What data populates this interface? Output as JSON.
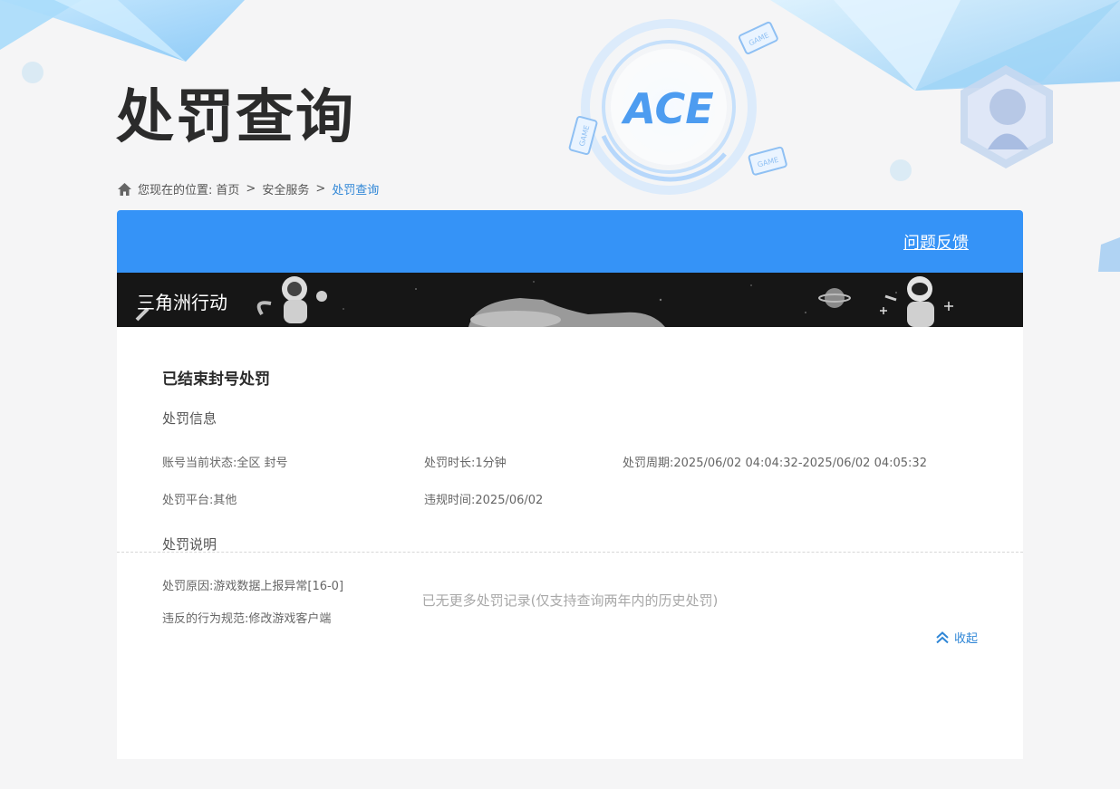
{
  "page": {
    "title": "处罚查询"
  },
  "breadcrumb": {
    "prefix": "您现在的位置:",
    "home": "首页",
    "sep1": ">",
    "section": "安全服务",
    "sep2": ">",
    "current": "处罚查询"
  },
  "header": {
    "feedback_label": "问题反馈"
  },
  "game": {
    "name": "三角洲行动"
  },
  "record": {
    "status_title": "已结束封号处罚",
    "info_section_title": "处罚信息",
    "account_status": "账号当前状态:全区 封号",
    "duration": "处罚时长:1分钟",
    "period": "处罚周期:2025/06/02 04:04:32-2025/06/02 04:05:32",
    "platform": "处罚平台:其他",
    "violation_time": "违规时间:2025/06/02",
    "desc_section_title": "处罚说明",
    "reason": "处罚原因:游戏数据上报异常[16-0]",
    "rule": "违反的行为规范:修改游戏客户端",
    "collapse_label": "收起"
  },
  "footer": {
    "no_more_text": "已无更多处罚记录(仅支持查询两年内的历史处罚)"
  },
  "colors": {
    "accent": "#3593f7",
    "link": "#2f86d6",
    "title": "#2b2b2b"
  },
  "icons": {
    "home": "home-icon",
    "collapse": "double-chevron-up-icon"
  }
}
